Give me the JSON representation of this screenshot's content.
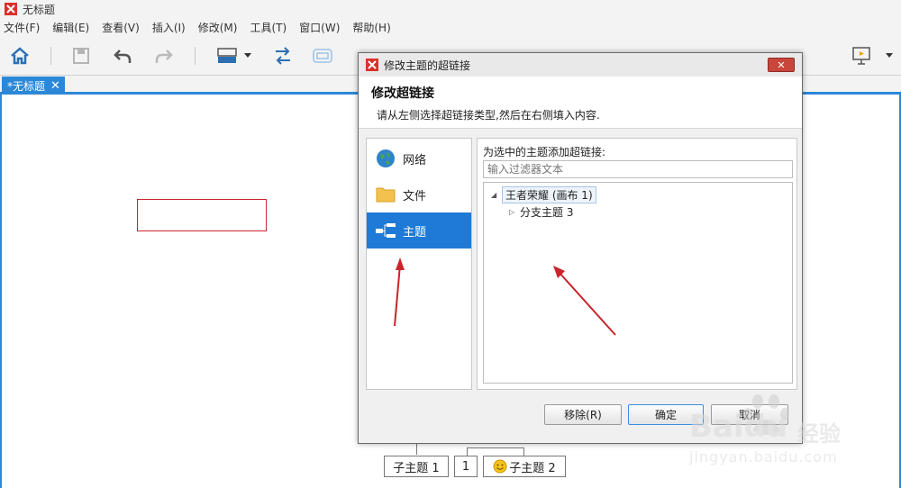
{
  "window": {
    "title": "无标题"
  },
  "menubar": {
    "items": [
      "文件(F)",
      "编辑(E)",
      "查看(V)",
      "插入(I)",
      "修改(M)",
      "工具(T)",
      "窗口(W)",
      "帮助(H)"
    ]
  },
  "tabs": {
    "doc_tab": "*无标题",
    "close": "✕"
  },
  "mindmap": {
    "topic1": "子主题 1",
    "topic_number": "1",
    "topic2": "子主题 2"
  },
  "dialog": {
    "title": "修改主题的超链接",
    "close": "✕",
    "header_title": "修改超链接",
    "header_desc": "请从左侧选择超链接类型,然后在右侧填入内容.",
    "left_items": [
      "网络",
      "文件",
      "主题"
    ],
    "selected_item": "主题",
    "right_label": "为选中的主题添加超链接:",
    "filter_placeholder": "输入过滤器文本",
    "tree": {
      "root_label": "王者荣耀 (画布 1)",
      "child_label": "分支主题 3"
    },
    "buttons": {
      "remove": "移除(R)",
      "ok": "确定",
      "cancel": "取消"
    }
  },
  "watermark": {
    "brand": "Baidu",
    "cn": "经验",
    "url": "jingyan.baidu.com"
  },
  "colors": {
    "accent": "#2b88d8",
    "selected": "#1e7ad6",
    "annotation": "#c9252b"
  }
}
